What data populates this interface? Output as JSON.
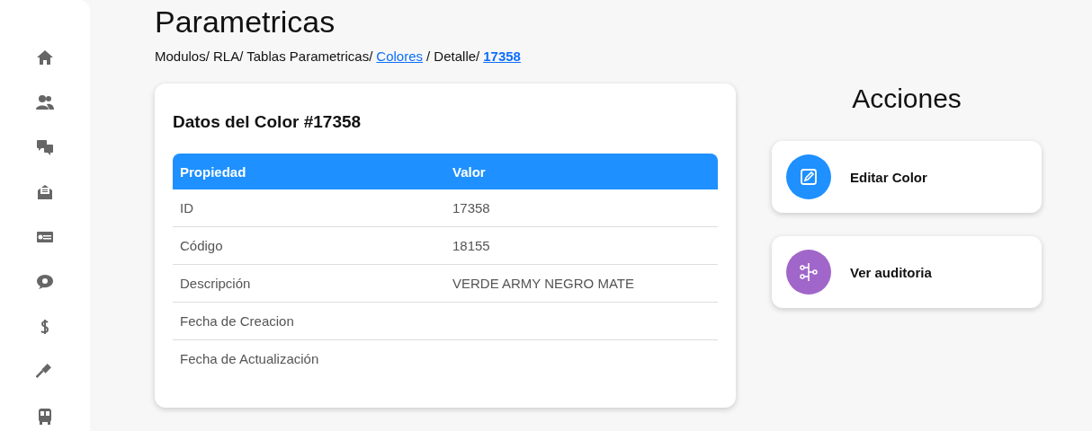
{
  "page": {
    "title": "Parametricas"
  },
  "breadcrumb": [
    {
      "label": "Modulos/ RLA/ Tablas Parametricas/",
      "kind": "text"
    },
    {
      "label": "Colores",
      "kind": "link"
    },
    {
      "label": "/ Detalle/",
      "kind": "text"
    },
    {
      "label": "17358",
      "kind": "current"
    }
  ],
  "detail_card": {
    "title": "Datos del Color #17358",
    "columns": [
      "Propiedad",
      "Valor"
    ],
    "rows": [
      {
        "property": "ID",
        "value": "17358"
      },
      {
        "property": "Código",
        "value": "18155"
      },
      {
        "property": "Descripción",
        "value": "VERDE ARMY NEGRO MATE"
      },
      {
        "property": "Fecha de Creacion"
      },
      {
        "property": "Fecha de Actualización"
      }
    ]
  },
  "actions": {
    "title": "Acciones",
    "items": [
      {
        "label": "Editar Color",
        "kind": "edit",
        "color": "#1e90ff"
      },
      {
        "label": "Ver auditoria",
        "kind": "audit",
        "color": "#a066c9"
      }
    ]
  }
}
